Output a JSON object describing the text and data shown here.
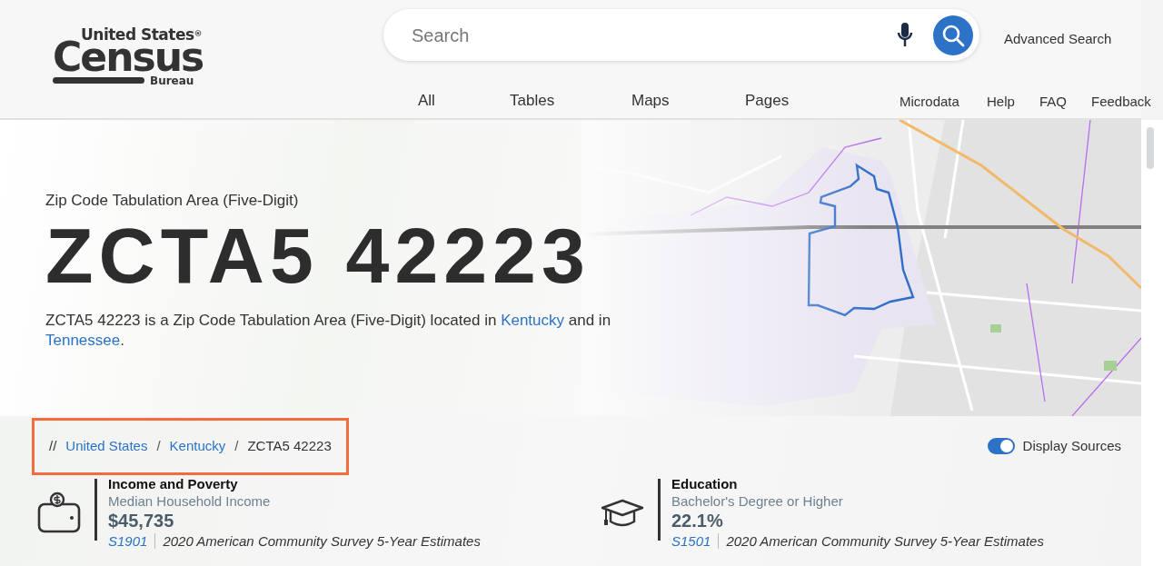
{
  "header": {
    "logo": {
      "top": "United States$^{®}$",
      "main": "Census",
      "bottom": "Bureau"
    },
    "search": {
      "placeholder": "Search"
    },
    "advanced_search": "Advanced Search",
    "tabs": [
      {
        "label": "All"
      },
      {
        "label": "Tables"
      },
      {
        "label": "Maps"
      },
      {
        "label": "Pages"
      }
    ],
    "links": [
      "Microdata",
      "Help",
      "FAQ",
      "Feedback"
    ]
  },
  "hero": {
    "subtitle": "Zip Code Tabulation Area (Five-Digit)",
    "title": "ZCTA5 42223",
    "description": [
      {
        "kind": "text",
        "text": "ZCTA5 42223 is a Zip Code Tabulation Area (Five-Digit) located in "
      },
      {
        "kind": "link",
        "text": "Kentucky"
      },
      {
        "kind": "text",
        "text": " and in "
      },
      {
        "kind": "link",
        "text": "Tennessee"
      },
      {
        "kind": "text",
        "text": "."
      }
    ]
  },
  "breadcrumb": {
    "highlighted": true,
    "prefix": "//",
    "items": [
      {
        "kind": "link",
        "text": "United States"
      },
      {
        "kind": "separator",
        "text": "/"
      },
      {
        "kind": "link",
        "text": "Kentucky"
      },
      {
        "kind": "separator",
        "text": "/"
      },
      {
        "kind": "current",
        "text": "ZCTA5 42223"
      }
    ]
  },
  "display_sources": {
    "label": "Display Sources",
    "on": true
  },
  "stats": [
    {
      "kind": "income",
      "category": "Income and Poverty",
      "measure": "Median Household Income",
      "value": "$45,735",
      "table": "S1901",
      "survey": "2020 American Community Survey 5-Year Estimates"
    },
    {
      "kind": "education",
      "category": "Education",
      "measure": "Bachelor's Degree or Higher",
      "value": "22.1%",
      "table": "S1501",
      "survey": "2020 American Community Survey 5-Year Estimates"
    }
  ]
}
